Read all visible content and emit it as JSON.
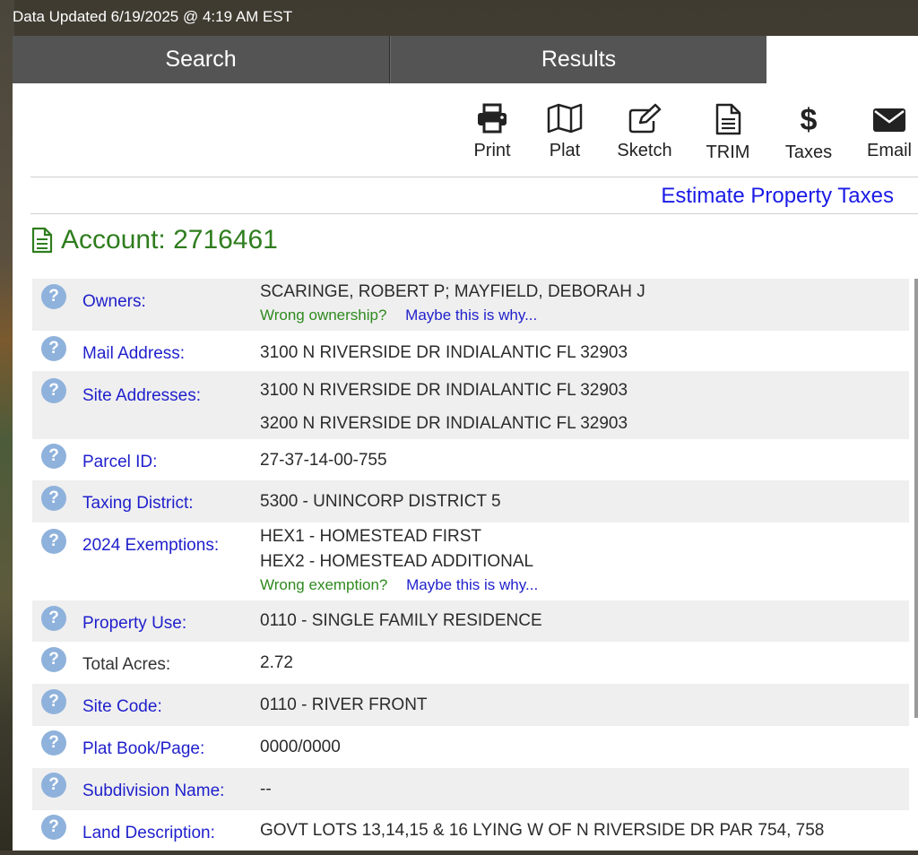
{
  "update_bar": "Data Updated 6/19/2025 @ 4:19 AM EST",
  "tabs": {
    "search": "Search",
    "results": "Results"
  },
  "toolbar": [
    {
      "label": "Print",
      "icon": "print-icon"
    },
    {
      "label": "Plat",
      "icon": "map-icon"
    },
    {
      "label": "Sketch",
      "icon": "pencil-square-icon"
    },
    {
      "label": "TRIM",
      "icon": "document-icon"
    },
    {
      "label": "Taxes",
      "icon": "dollar-icon"
    },
    {
      "label": "Email",
      "icon": "envelope-icon"
    }
  ],
  "estimate_link": "Estimate Property Taxes",
  "account": {
    "title": "Account: 2716461",
    "icon": "file-text-icon"
  },
  "rows": [
    {
      "label": "Owners:",
      "values": [
        "SCARINGE, ROBERT P; MAYFIELD, DEBORAH J"
      ],
      "help_q": "Wrong ownership?",
      "help_a": "Maybe this is why..."
    },
    {
      "label": "Mail Address:",
      "values": [
        "3100 N RIVERSIDE DR INDIALANTIC FL 32903"
      ]
    },
    {
      "label": "Site Addresses:",
      "values": [
        "3100 N RIVERSIDE DR INDIALANTIC FL 32903",
        "3200 N RIVERSIDE DR INDIALANTIC FL 32903"
      ]
    },
    {
      "label": "Parcel ID:",
      "values": [
        "27-37-14-00-755"
      ]
    },
    {
      "label": "Taxing District:",
      "values": [
        "5300 - UNINCORP DISTRICT 5"
      ]
    },
    {
      "label": "2024 Exemptions:",
      "values": [
        "HEX1 - HOMESTEAD FIRST",
        "HEX2 - HOMESTEAD ADDITIONAL"
      ],
      "help_q": "Wrong exemption?",
      "help_a": "Maybe this is why..."
    },
    {
      "label": "Property Use:",
      "values": [
        "0110 - SINGLE FAMILY RESIDENCE"
      ]
    },
    {
      "label": "Total Acres:",
      "values": [
        "2.72"
      ]
    },
    {
      "label": "Site Code:",
      "values": [
        "0110 - RIVER FRONT"
      ]
    },
    {
      "label": "Plat Book/Page:",
      "values": [
        "0000/0000"
      ]
    },
    {
      "label": "Subdivision Name:",
      "values": [
        "--"
      ]
    },
    {
      "label": "Land Description:",
      "values": [
        "GOVT LOTS 13,14,15 & 16 LYING W OF N RIVERSIDE DR PAR 754, 758"
      ]
    }
  ],
  "help_glyph": "?",
  "colors": {
    "link": "#1f1fcc",
    "account": "#2f7d1e",
    "help_circle": "#8fb2dc",
    "tab": "#545454"
  }
}
